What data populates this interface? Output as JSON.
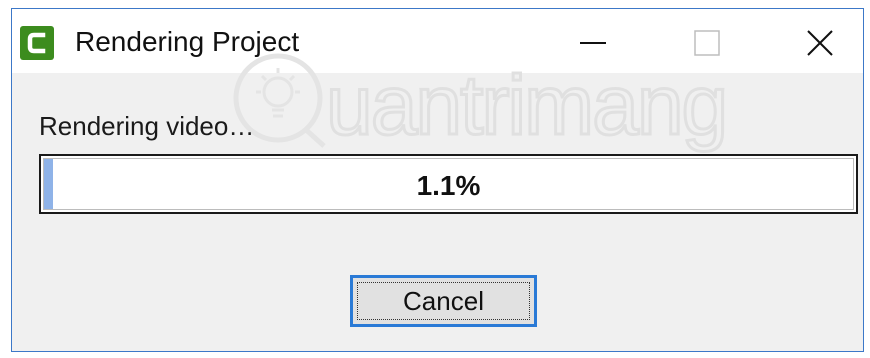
{
  "window": {
    "title": "Rendering Project",
    "icon": "camtasia-c-icon",
    "controls": [
      "minimize-icon",
      "maximize-icon",
      "close-icon"
    ]
  },
  "status": {
    "label": "Rendering video…"
  },
  "progress": {
    "value": 0.011,
    "text": "1.1%"
  },
  "buttons": {
    "cancel": "Cancel"
  },
  "watermark": {
    "text": "Quantrimang"
  },
  "colors": {
    "accent": "#2a7ad6",
    "icon_green": "#3c8c1e",
    "window_bg": "#f0f0f0",
    "progress_fill": "#8fb3e8"
  }
}
